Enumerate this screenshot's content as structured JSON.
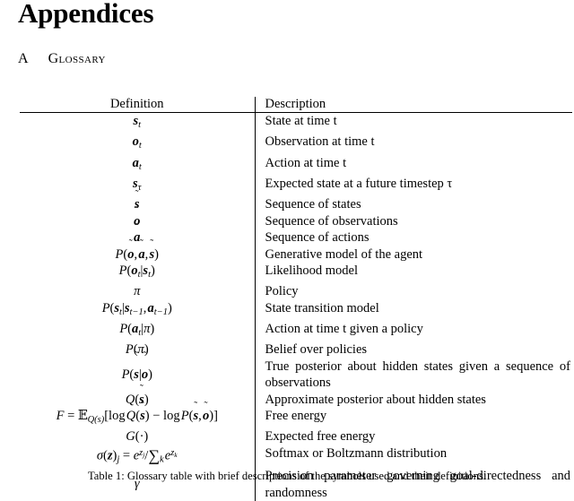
{
  "document": {
    "title": "Appendices",
    "section": {
      "letter": "A",
      "name": "Glossary"
    }
  },
  "table": {
    "headers": {
      "definition": "Definition",
      "description": "Description"
    },
    "rows": [
      {
        "symbol_plain": "s_t",
        "description": "State at time t"
      },
      {
        "symbol_plain": "o_t",
        "description": "Observation at time t"
      },
      {
        "symbol_plain": "a_t",
        "description": "Action at time t"
      },
      {
        "symbol_plain": "s_tau",
        "description": "Expected state at a future timestep τ"
      },
      {
        "symbol_plain": "s-tilde",
        "description": "Sequence of states"
      },
      {
        "symbol_plain": "o-tilde",
        "description": "Sequence of observations"
      },
      {
        "symbol_plain": "a-tilde",
        "description": "Sequence of actions"
      },
      {
        "symbol_plain": "P(o-tilde, a-tilde, s-tilde)",
        "description": "Generative model of the agent"
      },
      {
        "symbol_plain": "P(o_t|s_t)",
        "description": "Likelihood model"
      },
      {
        "symbol_plain": "pi",
        "description": "Policy"
      },
      {
        "symbol_plain": "P(s_t|s_{t-1}, a_{t-1})",
        "description": "State transition model"
      },
      {
        "symbol_plain": "P(a_t|pi)",
        "description": "Action at time t given a policy"
      },
      {
        "symbol_plain": "P(pi)",
        "description": "Belief over policies"
      },
      {
        "symbol_plain": "P(s-tilde|o-tilde)",
        "description": "True posterior about hidden states given a sequence of observations"
      },
      {
        "symbol_plain": "Q(s-tilde)",
        "description": "Approximate posterior about hidden states"
      },
      {
        "symbol_plain": "F = E_{Q(s)}[log Q(s-tilde) - log P(s-tilde, o-tilde)]",
        "description": "Free energy"
      },
      {
        "symbol_plain": "G(.)",
        "description": "Expected free energy"
      },
      {
        "symbol_plain": "sigma(z)_j = e^{z_j} / sum_k e^{z_k}",
        "description": "Softmax or Boltzmann distribution"
      },
      {
        "symbol_plain": "gamma",
        "description": "Precision parameter governing goal-directedness and randomness"
      }
    ]
  },
  "caption": {
    "text": "Table 1: Glossary table with brief descriptions of the symbols used and their definitions."
  }
}
